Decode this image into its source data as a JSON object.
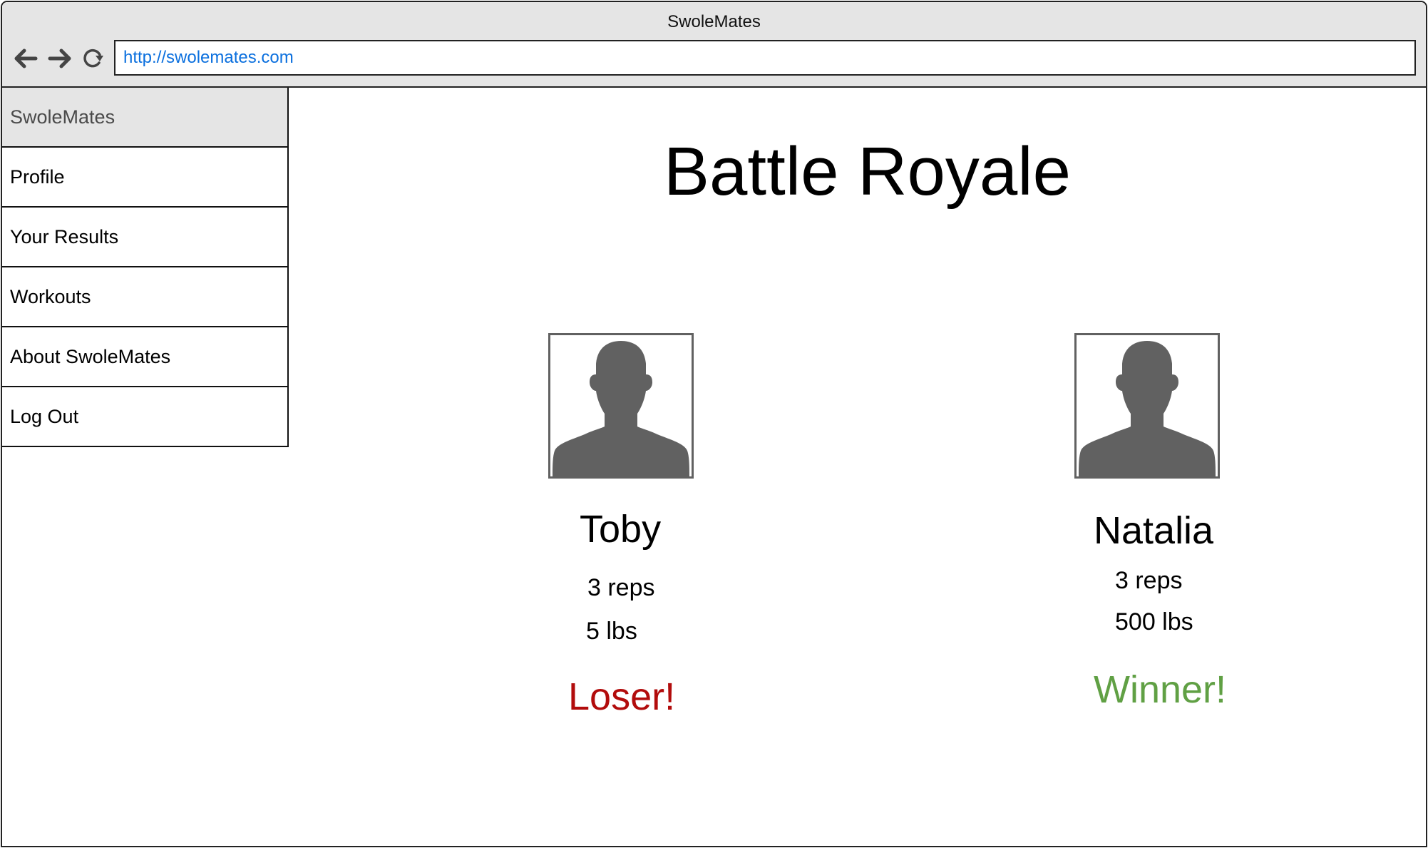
{
  "browser": {
    "window_title": "SwoleMates",
    "url": "http://swolemates.com",
    "icons": {
      "back": "arrow-left-icon",
      "forward": "arrow-right-icon",
      "reload": "reload-icon"
    }
  },
  "sidebar": {
    "header": "SwoleMates",
    "items": [
      {
        "label": "Profile"
      },
      {
        "label": "Your Results"
      },
      {
        "label": "Workouts"
      },
      {
        "label": "About SwoleMates"
      },
      {
        "label": "Log Out"
      }
    ]
  },
  "main": {
    "title": "Battle Royale",
    "players": [
      {
        "name": "Toby",
        "reps": "3 reps",
        "weight": "5 lbs",
        "result": "Loser!",
        "result_color": "#b20c0c",
        "avatar_icon": "user-silhouette-icon"
      },
      {
        "name": "Natalia",
        "reps": "3 reps",
        "weight": "500 lbs",
        "result": "Winner!",
        "result_color": "#60a044",
        "avatar_icon": "user-silhouette-icon"
      }
    ]
  },
  "colors": {
    "chrome_bg": "#e5e5e5",
    "url_text": "#0a6fde",
    "avatar_fill": "#616161",
    "loser": "#b20c0c",
    "winner": "#60a044"
  }
}
